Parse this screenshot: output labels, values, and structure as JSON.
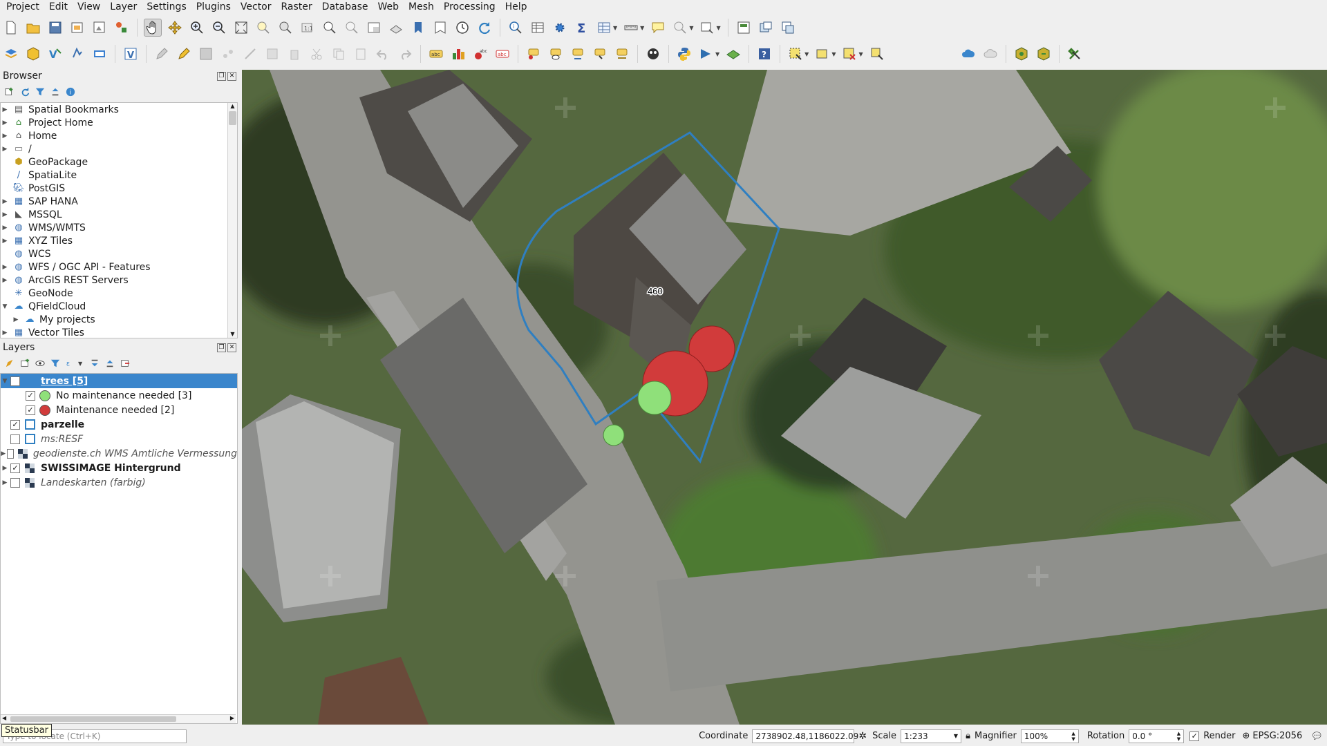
{
  "menu": [
    "Project",
    "Edit",
    "View",
    "Layer",
    "Settings",
    "Plugins",
    "Vector",
    "Raster",
    "Database",
    "Web",
    "Mesh",
    "Processing",
    "Help"
  ],
  "browser": {
    "title": "Browser",
    "items": [
      {
        "label": "Spatial Bookmarks",
        "icon": "bookmark-icon",
        "expand": true
      },
      {
        "label": "Project Home",
        "icon": "project-home-icon",
        "expand": true
      },
      {
        "label": "Home",
        "icon": "home-icon",
        "expand": true
      },
      {
        "label": "/",
        "icon": "folder-icon",
        "expand": true
      },
      {
        "label": "GeoPackage",
        "icon": "geopackage-icon",
        "expand": false
      },
      {
        "label": "SpatiaLite",
        "icon": "spatialite-icon",
        "expand": false
      },
      {
        "label": "PostGIS",
        "icon": "postgis-icon",
        "expand": false
      },
      {
        "label": "SAP HANA",
        "icon": "saphana-icon",
        "expand": true
      },
      {
        "label": "MSSQL",
        "icon": "mssql-icon",
        "expand": true
      },
      {
        "label": "WMS/WMTS",
        "icon": "wms-icon",
        "expand": true
      },
      {
        "label": "XYZ Tiles",
        "icon": "xyz-tiles-icon",
        "expand": true
      },
      {
        "label": "WCS",
        "icon": "wcs-icon",
        "expand": false
      },
      {
        "label": "WFS / OGC API - Features",
        "icon": "wfs-icon",
        "expand": true
      },
      {
        "label": "ArcGIS REST Servers",
        "icon": "arcgis-icon",
        "expand": true
      },
      {
        "label": "GeoNode",
        "icon": "geonode-icon",
        "expand": false
      },
      {
        "label": "QFieldCloud",
        "icon": "cloud-icon",
        "expand": true,
        "open": true
      },
      {
        "label": "My projects",
        "icon": "cloud-icon",
        "expand": true,
        "child": true
      },
      {
        "label": "Vector Tiles",
        "icon": "vector-tiles-icon",
        "expand": true
      }
    ]
  },
  "layers": {
    "title": "Layers",
    "items": [
      {
        "label": "trees [5]",
        "checked": true,
        "style": "selected",
        "indent": 0,
        "expand": "open"
      },
      {
        "label": "No maintenance needed [3]",
        "checked": true,
        "indent": 1,
        "symbol": "green"
      },
      {
        "label": "Maintenance needed [2]",
        "checked": true,
        "indent": 1,
        "symbol": "red"
      },
      {
        "label": "parzelle",
        "checked": true,
        "indent": 0,
        "style": "bold",
        "symbol": "polygon"
      },
      {
        "label": "ms:RESF",
        "checked": false,
        "indent": 0,
        "style": "italic",
        "symbol": "polygon"
      },
      {
        "label": "geodienste.ch WMS Amtliche Vermessung",
        "checked": false,
        "indent": 0,
        "style": "italic",
        "symbol": "raster",
        "expand": "closed"
      },
      {
        "label": "SWISSIMAGE Hintergrund",
        "checked": true,
        "indent": 0,
        "style": "bold",
        "symbol": "raster",
        "expand": "closed"
      },
      {
        "label": "Landeskarten (farbig)",
        "checked": false,
        "indent": 0,
        "style": "italic",
        "symbol": "raster",
        "expand": "closed"
      }
    ]
  },
  "colors": {
    "maintenance_needed": "#d13b3b",
    "no_maintenance": "#8fe07a",
    "parcel_outline": "#2f7fc1",
    "selection": "#3a86cc"
  },
  "map": {
    "parcel_label": "460"
  },
  "status": {
    "tooltip": "Statusbar",
    "locate_placeholder": "Type to locate (Ctrl+K)",
    "coordinate_label": "Coordinate",
    "coordinate_value": "2738902.48,1186022.09",
    "scale_label": "Scale",
    "scale_value": "1:233",
    "magnifier_label": "Magnifier",
    "magnifier_value": "100%",
    "rotation_label": "Rotation",
    "rotation_value": "0.0 °",
    "render_label": "Render",
    "crs_value": "EPSG:2056"
  }
}
